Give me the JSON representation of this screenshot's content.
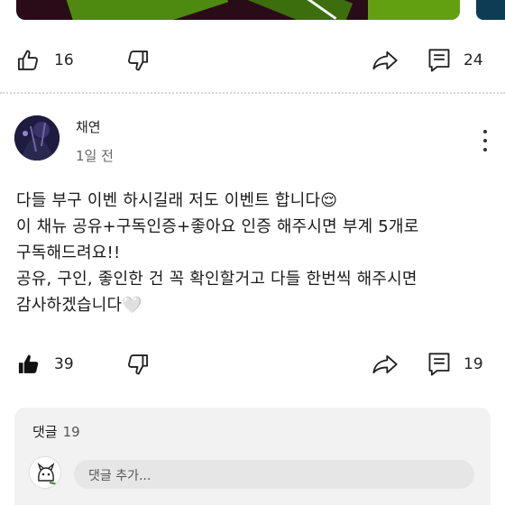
{
  "post_actions": {
    "like_count": "16",
    "comment_count": "24"
  },
  "comment": {
    "author": "채연",
    "time": "1일 전",
    "lines": [
      "다들 부구 이벤 하시길래 저도 이벤트 합니다😌",
      "이 채뉴 공유+구독인증+좋아요 인증 해주시면 부계 5개로",
      "구독해드려요!!",
      "공유, 구인, 좋인한 건 꼭 확인할거고 다들 한번씩 해주시면",
      "감사하겠습니다🤍"
    ],
    "like_count": "39",
    "reply_count": "19"
  },
  "replies": {
    "title": "댓글",
    "count": "19",
    "input_placeholder": "댓글 추가..."
  },
  "icons": [
    "thumbs-up-icon",
    "thumbs-down-icon",
    "share-icon",
    "comment-icon",
    "more-vertical-icon"
  ]
}
